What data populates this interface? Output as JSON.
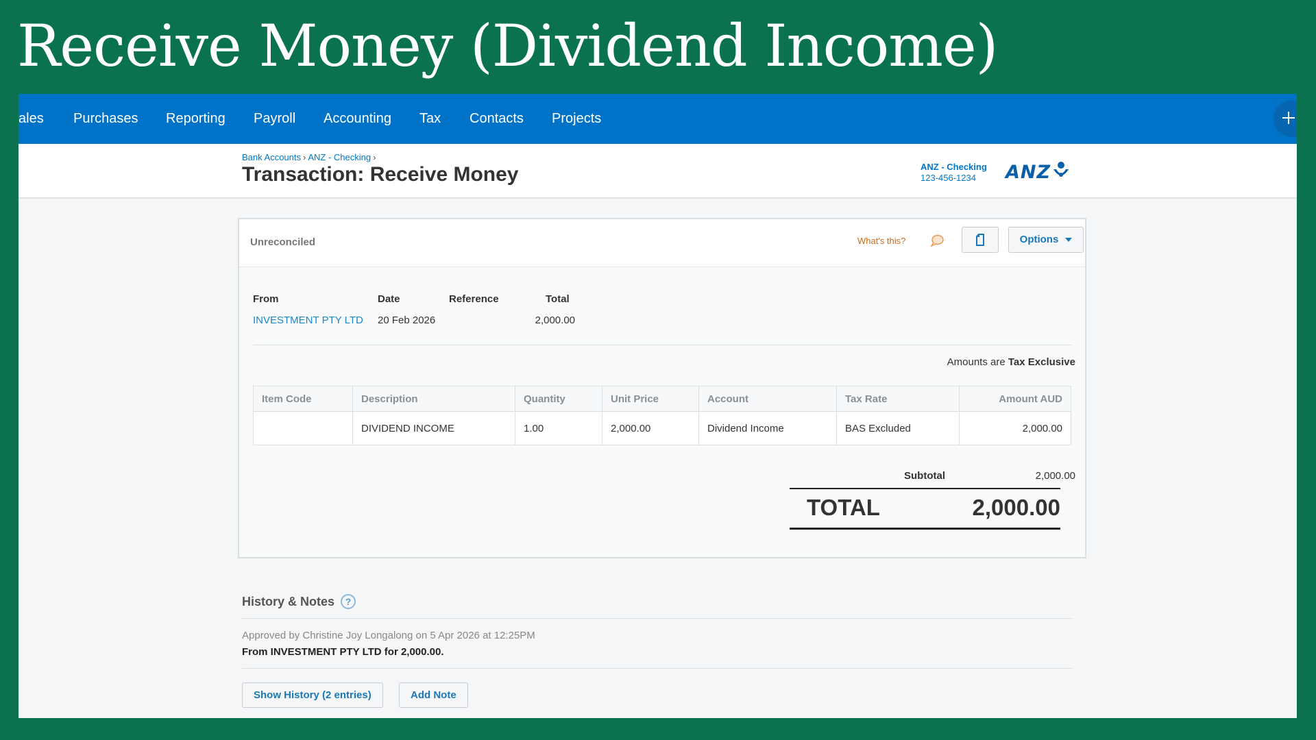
{
  "slide": {
    "title": "Receive Money (Dividend Income)"
  },
  "nav": {
    "items": [
      "ales",
      "Purchases",
      "Reporting",
      "Payroll",
      "Accounting",
      "Tax",
      "Contacts",
      "Projects"
    ]
  },
  "header": {
    "breadcrumb": [
      "Bank Accounts",
      "ANZ - Checking"
    ],
    "breadcrumb_sep": "›",
    "title": "Transaction: Receive Money",
    "account_name": "ANZ - Checking",
    "account_number": "123-456-1234",
    "bank_logo_text": "ANZ"
  },
  "panel": {
    "status": "Unreconciled",
    "whats_this": "What's this?",
    "options_label": "Options",
    "from_label": "From",
    "date_label": "Date",
    "reference_label": "Reference",
    "total_label": "Total",
    "from_value": "INVESTMENT PTY LTD",
    "date_value": "20 Feb 2026",
    "reference_value": "",
    "total_value": "2,000.00",
    "amounts_prefix": "Amounts are",
    "amounts_mode": "Tax Exclusive"
  },
  "table": {
    "headers": [
      "Item Code",
      "Description",
      "Quantity",
      "Unit Price",
      "Account",
      "Tax Rate",
      "Amount AUD"
    ],
    "rows": [
      [
        "",
        "DIVIDEND INCOME",
        "1.00",
        "2,000.00",
        "Dividend Income",
        "BAS Excluded",
        "2,000.00"
      ]
    ]
  },
  "totals": {
    "subtotal_label": "Subtotal",
    "subtotal_value": "2,000.00",
    "total_label": "TOTAL",
    "total_value": "2,000.00"
  },
  "history": {
    "title": "History & Notes",
    "help": "?",
    "line1": "Approved by Christine Joy Longalong on 5 Apr 2026 at 12:25PM",
    "line2": "From INVESTMENT PTY LTD for 2,000.00.",
    "show_history_label": "Show History (2 entries)",
    "add_note_label": "Add Note"
  },
  "colors": {
    "slide_bg": "#0b7250",
    "nav_bg": "#0073c8",
    "link": "#1a87c9",
    "whats_this": "#cc6a17"
  }
}
